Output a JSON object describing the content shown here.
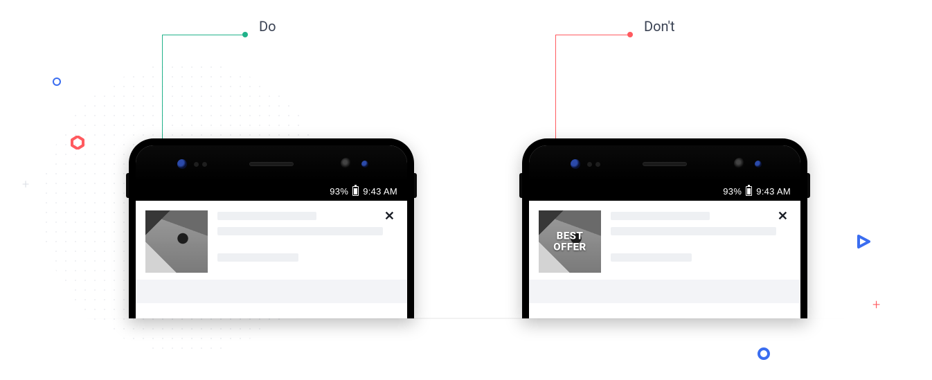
{
  "labels": {
    "do": "Do",
    "dont": "Don't"
  },
  "status_bar": {
    "battery_pct": "93%",
    "time": "9:43 AM"
  },
  "card": {
    "close_glyph": "✕",
    "dont_overlay_line1": "BEST",
    "dont_overlay_line2": "OFFER"
  }
}
